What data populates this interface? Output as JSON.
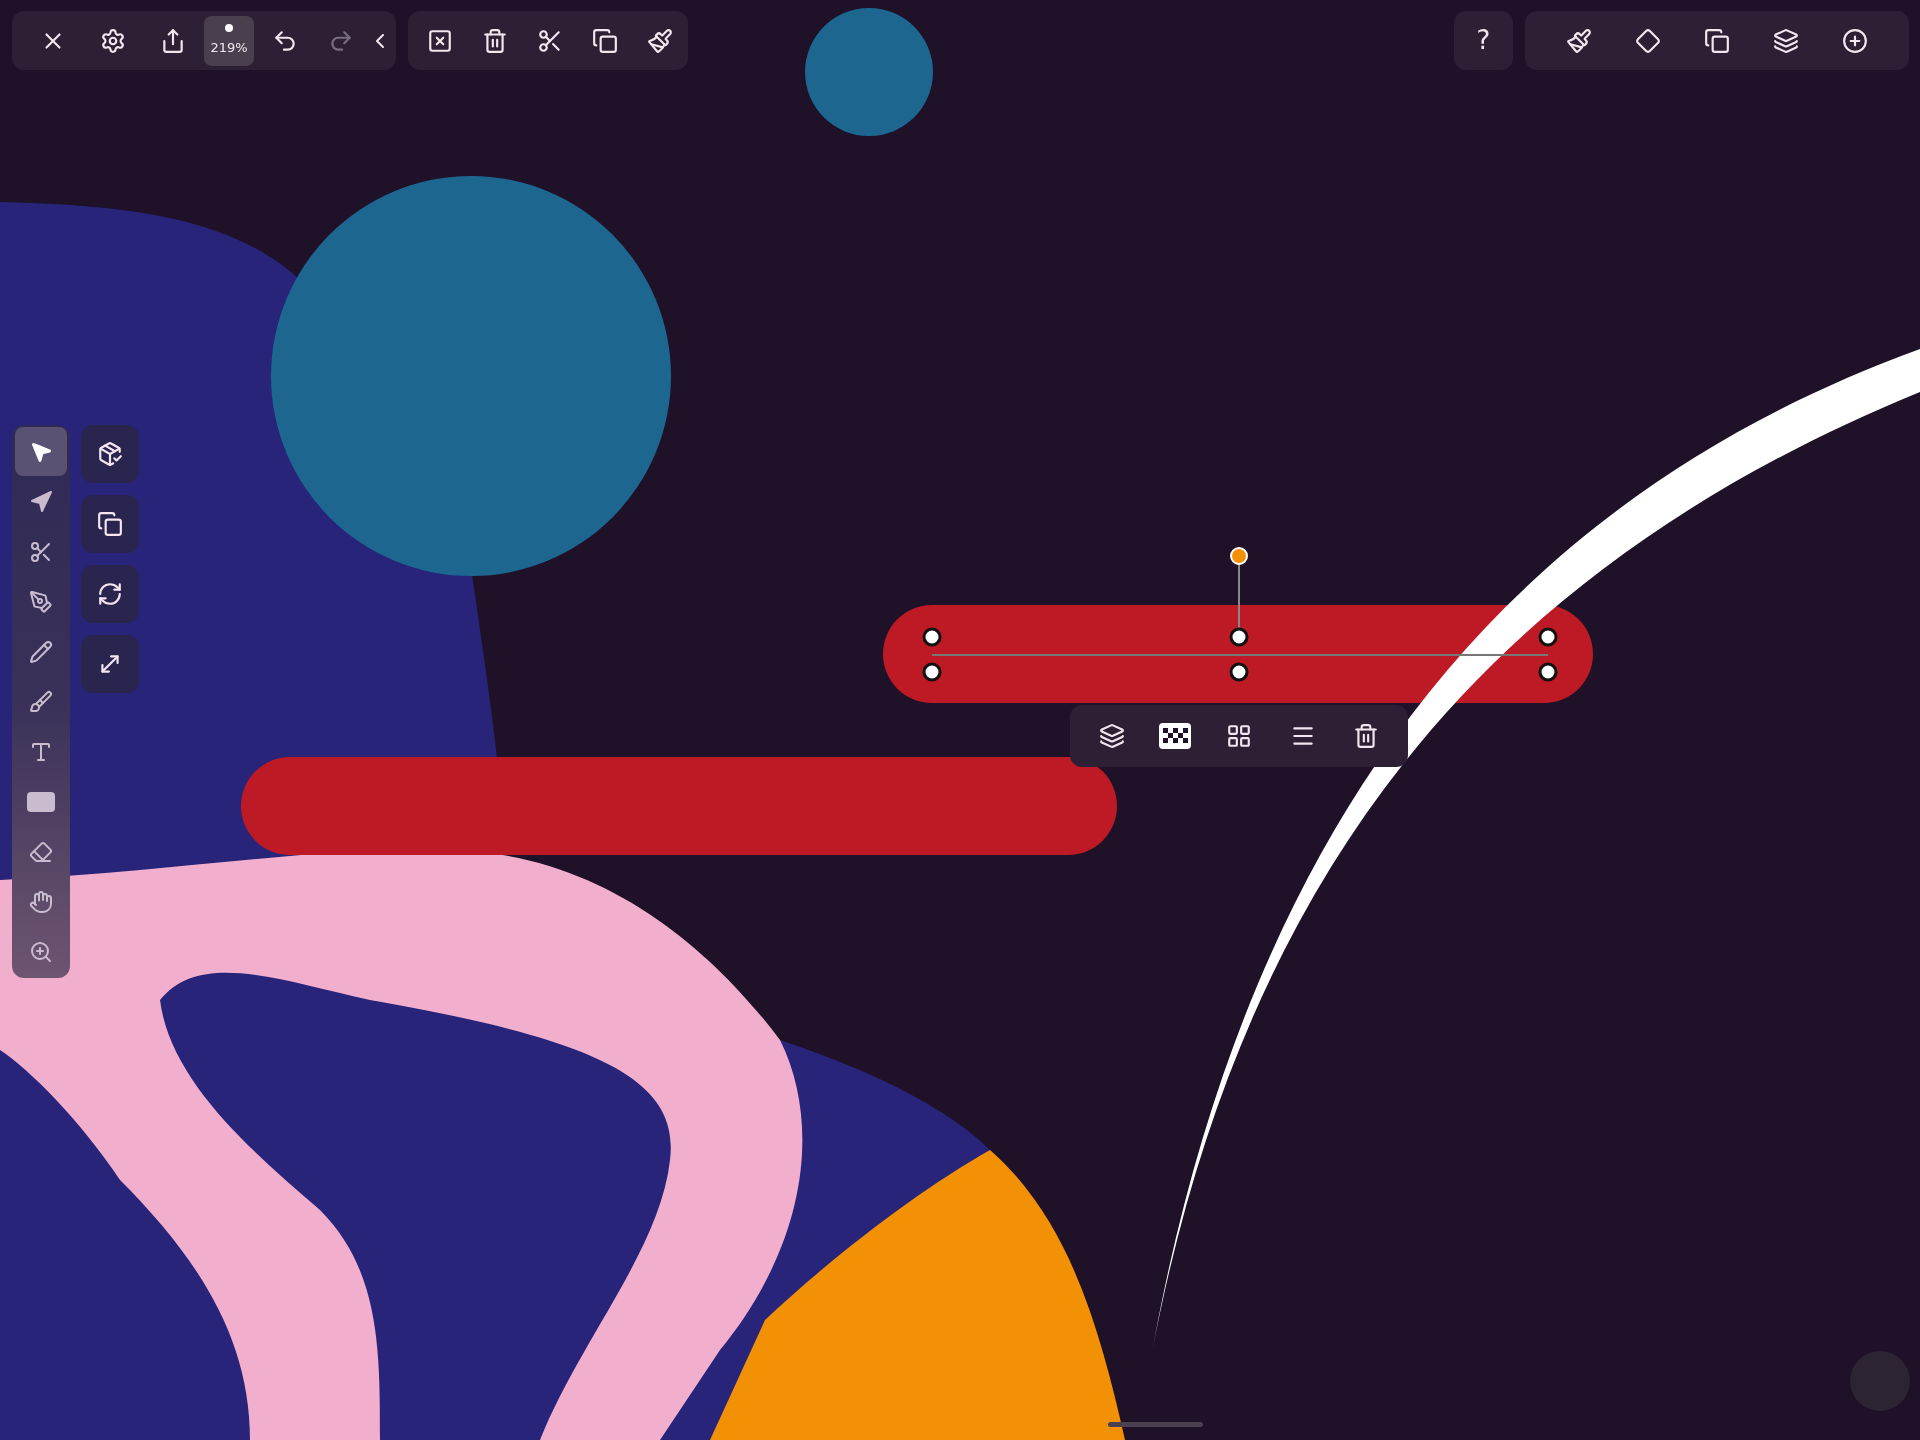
{
  "top_bar": {
    "zoom": {
      "label": "219%"
    },
    "redo": {
      "disabled": true
    }
  },
  "help_button": {
    "label": "?"
  },
  "tools": [
    {
      "kind": "select",
      "selected": true
    },
    {
      "kind": "direct",
      "selected": false
    },
    {
      "kind": "scissors",
      "selected": false
    },
    {
      "kind": "pen",
      "selected": false
    },
    {
      "kind": "pencil",
      "selected": false
    },
    {
      "kind": "brush",
      "selected": false
    },
    {
      "kind": "text",
      "selected": false
    },
    {
      "kind": "shape",
      "selected": false
    },
    {
      "kind": "eraser",
      "selected": false
    },
    {
      "kind": "hand",
      "selected": false
    },
    {
      "kind": "zoom",
      "selected": false
    }
  ]
}
